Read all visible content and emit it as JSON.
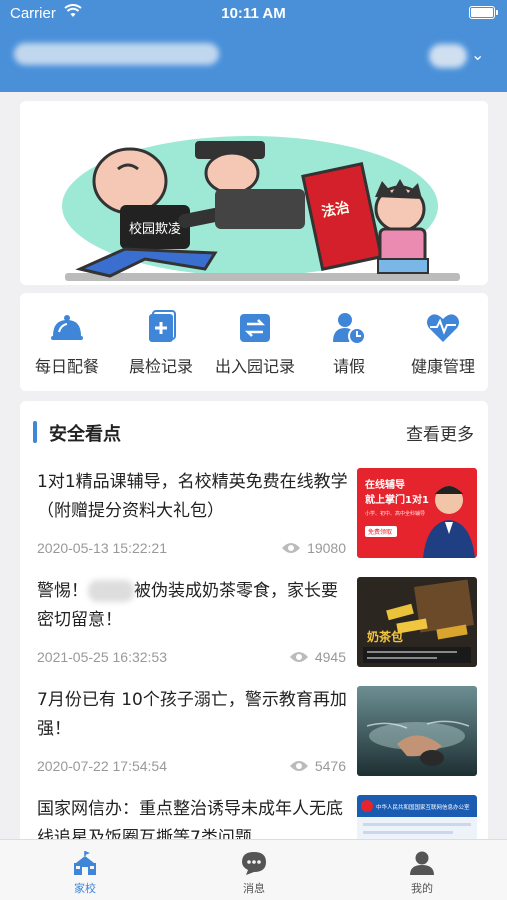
{
  "status_bar": {
    "carrier": "Carrier",
    "time": "10:11 AM"
  },
  "header": {
    "chevron": "⌄"
  },
  "quick_menu": [
    {
      "label": "每日配餐",
      "icon": "meal-icon"
    },
    {
      "label": "晨检记录",
      "icon": "check-record-icon"
    },
    {
      "label": "出入园记录",
      "icon": "in-out-icon"
    },
    {
      "label": "请假",
      "icon": "leave-icon"
    },
    {
      "label": "健康管理",
      "icon": "health-icon"
    }
  ],
  "news": {
    "title": "安全看点",
    "more": "查看更多",
    "articles": [
      {
        "title": "1对1精品课辅导，名校精英免费在线教学（附赠提分资料大礼包）",
        "date": "2020-05-13 15:22:21",
        "views": "19080"
      },
      {
        "title_pre": "警惕！",
        "title_post": "被伪装成奶茶零食，家长要密切留意！",
        "date": "2021-05-25 16:32:53",
        "views": "4945"
      },
      {
        "title": "7月份已有 10个孩子溺亡，警示教育再加强！",
        "date": "2020-07-22 17:54:54",
        "views": "5476"
      },
      {
        "title": "国家网信办：重点整治诱导未成年人无底线追星及饭圈互撕等7类问题",
        "date": "",
        "views": ""
      }
    ],
    "thumb1_text": {
      "line1": "在线辅导",
      "line2": "就上掌门1对1",
      "line3": "小学、初中、高中全科辅导",
      "badge": "免费领取"
    },
    "thumb2_text": {
      "label": "奶茶包"
    },
    "thumb4_text": {
      "label": "中华人民共和国国家互联网信息办公室"
    }
  },
  "banner": {
    "sign": "校园欺凌",
    "book": "法治"
  },
  "tabbar": [
    {
      "label": "家校",
      "icon": "school-icon",
      "active": true
    },
    {
      "label": "消息",
      "icon": "message-icon",
      "active": false
    },
    {
      "label": "我的",
      "icon": "profile-icon",
      "active": false
    }
  ],
  "colors": {
    "primary": "#4a90d9",
    "accent": "#3f86d8",
    "background": "#f0f0f2"
  }
}
